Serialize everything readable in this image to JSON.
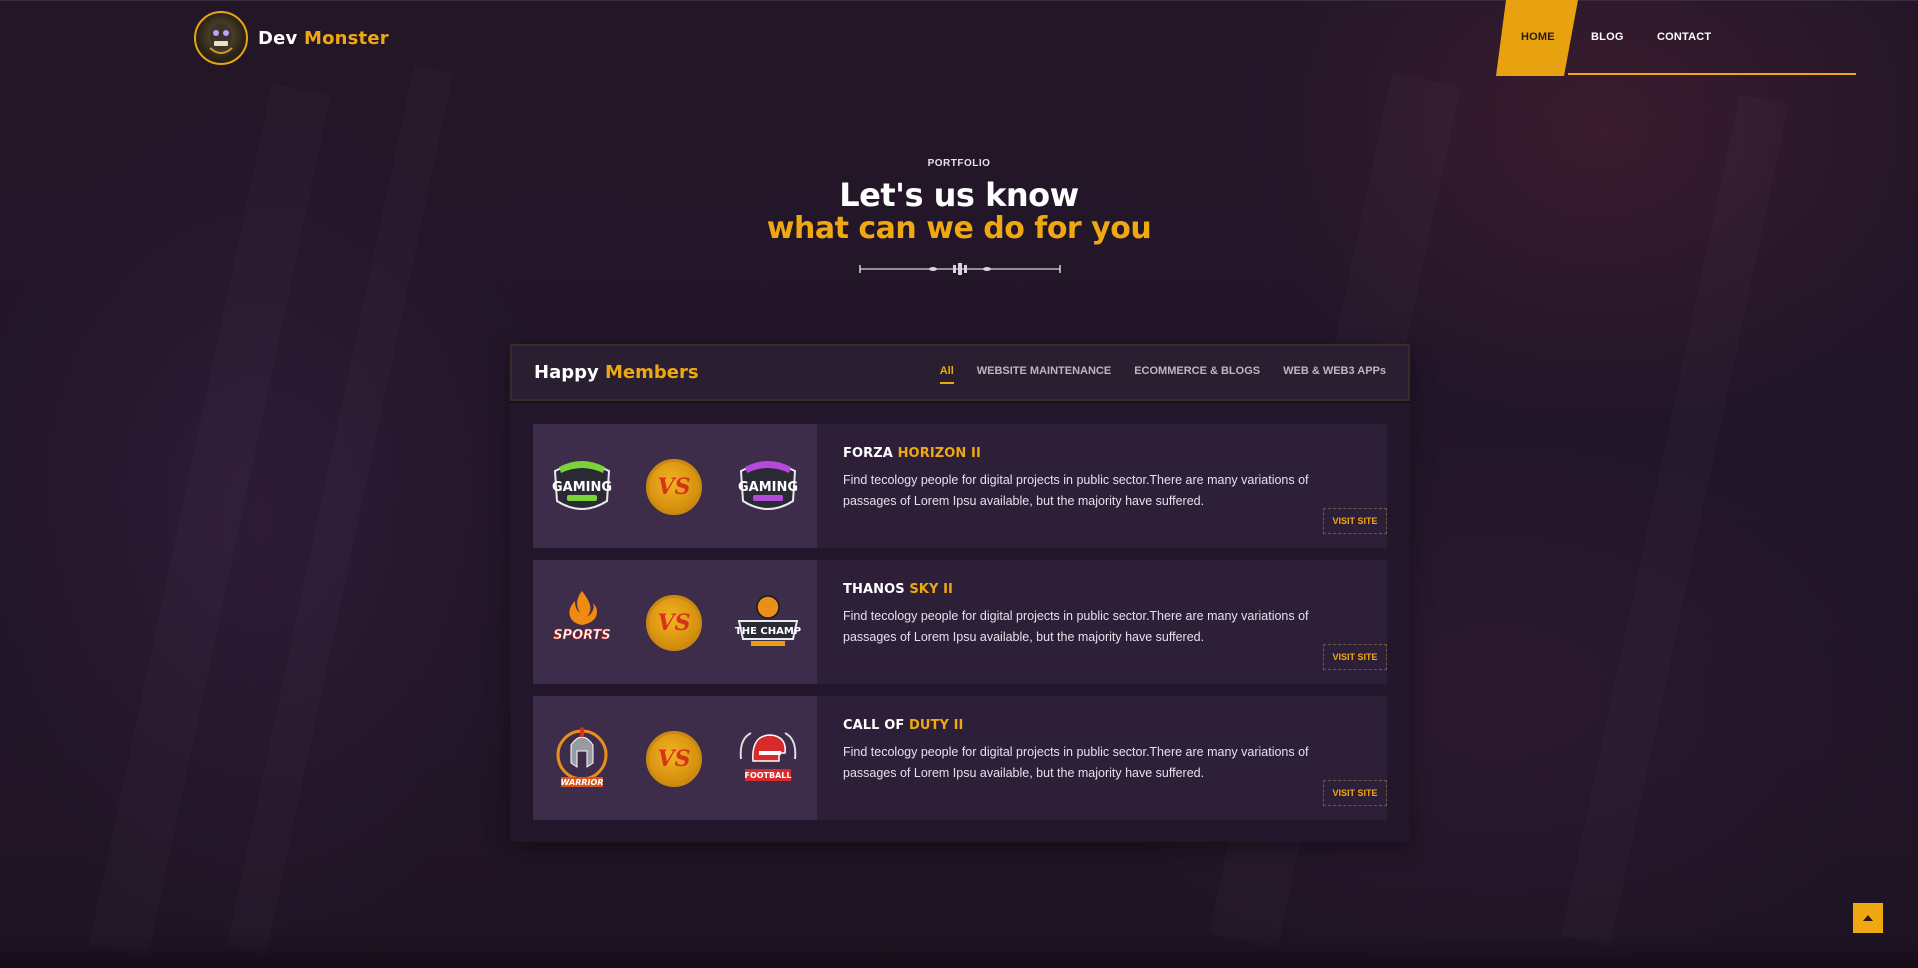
{
  "brand": {
    "first": "Dev",
    "second": "Monster"
  },
  "nav": {
    "items": [
      "HOME",
      "BLOG",
      "CONTACT"
    ],
    "active": "HOME"
  },
  "hero": {
    "eyebrow": "PORTFOLIO",
    "line1": "Let's us know",
    "line2": "what can we do for you"
  },
  "panel": {
    "title_first": "Happy",
    "title_second": "Members",
    "filters": [
      "All",
      "WEBSITE MAINTENANCE",
      "ECOMMERCE & BLOGS",
      "WEB & WEB3 APPs"
    ],
    "active_filter": "All"
  },
  "cards": [
    {
      "title_first": "FORZA",
      "title_second": "HORIZON II",
      "description": "Find tecology people for digital projects in public sector.There are many variations of passages of Lorem Ipsu available, but the majority have suffered.",
      "button": "VISIT SITE",
      "left_emblem": "GAMING",
      "right_emblem": "GAMING",
      "vs": "VS"
    },
    {
      "title_first": "THANOS",
      "title_second": "SKY II",
      "description": "Find tecology people for digital projects in public sector.There are many variations of passages of Lorem Ipsu available, but the majority have suffered.",
      "button": "VISIT SITE",
      "left_emblem": "SPORTS",
      "right_emblem": "THE CHAMP",
      "vs": "VS"
    },
    {
      "title_first": "CALL OF",
      "title_second": "DUTY II",
      "description": "Find tecology people for digital projects in public sector.There are many variations of passages of Lorem Ipsu available, but the majority have suffered.",
      "button": "VISIT SITE",
      "left_emblem": "WARRIOR",
      "right_emblem": "FOOTBALL",
      "vs": "VS"
    }
  ],
  "colors": {
    "accent": "#f0a812",
    "background": "#211528",
    "panel": "#22172a",
    "card": "#2c1f37"
  },
  "icons": {
    "scroll_top": "arrow-up-icon",
    "logo": "monster-logo-icon"
  }
}
